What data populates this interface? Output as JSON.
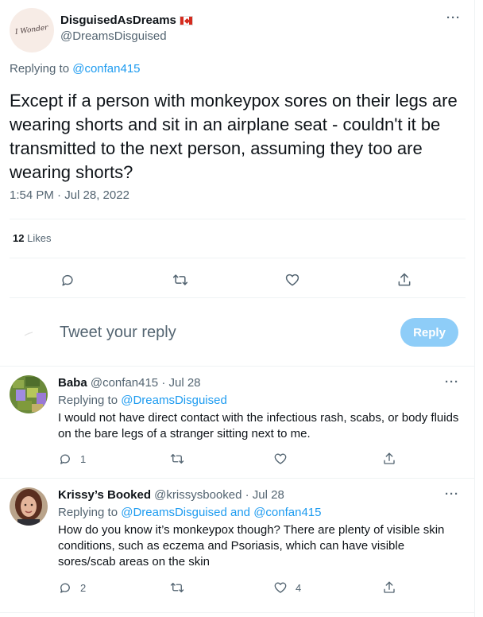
{
  "main_tweet": {
    "avatar_text": "I Wonder",
    "display_name": "DisguisedAsDreams",
    "handle": "@DreamsDisguised",
    "replying_prefix": "Replying to",
    "replying_to": "@confan415",
    "text": "Except if a person with monkeypox sores on their legs are wearing shorts and sit in an airplane seat - couldn't it be transmitted to the next person, assuming they too are wearing shorts?",
    "timestamp": "1:54 PM · Jul 28, 2022",
    "likes_count": "12",
    "likes_label": "Likes"
  },
  "reply_box": {
    "placeholder": "Tweet your reply",
    "button_label": "Reply"
  },
  "replies": [
    {
      "display_name": "Baba",
      "handle": "@confan415",
      "date": "· Jul 28",
      "replying_prefix": "Replying to",
      "replying_to": "@DreamsDisguised",
      "replying_and": "",
      "replying_to_2": "",
      "text": "I would not have direct contact with the infectious rash, scabs, or body fluids on the bare legs of a stranger sitting next to me.",
      "reply_count": "1",
      "retweet_count": "",
      "like_count": ""
    },
    {
      "display_name": "Krissy’s Booked",
      "handle": "@krissysbooked",
      "date": "· Jul 28",
      "replying_prefix": "Replying to",
      "replying_to": "@DreamsDisguised",
      "replying_and": "and",
      "replying_to_2": "@confan415",
      "text": "How do you know it’s monkeypox though? There are plenty of visible skin conditions, such as eczema and Psoriasis, which can have visible sores/scab areas on the skin",
      "reply_count": "2",
      "retweet_count": "",
      "like_count": "4"
    }
  ],
  "icons": {
    "reply": "reply-icon",
    "retweet": "retweet-icon",
    "like": "like-icon",
    "share": "share-icon",
    "more": "more-icon",
    "flag": "canada-flag-icon"
  },
  "colors": {
    "accent": "#1d9bf0",
    "reply_button_disabled": "#8ecdf8",
    "secondary_text": "#536471",
    "divider": "#eff3f4"
  }
}
